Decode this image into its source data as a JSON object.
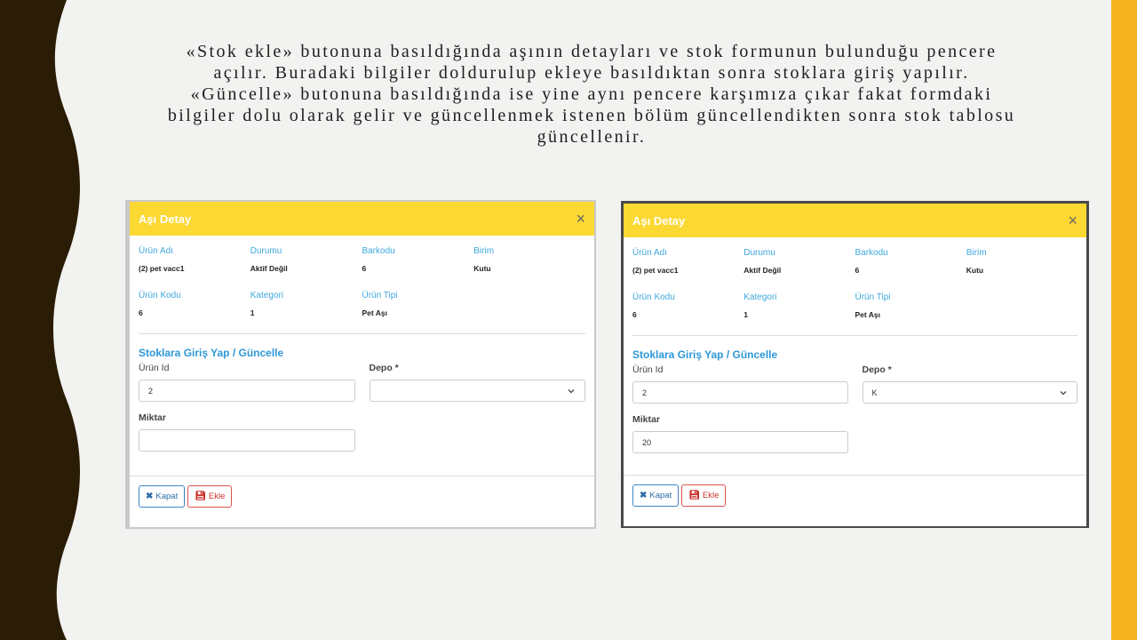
{
  "caption": {
    "lines": [
      "«Stok ekle» butonuna basıldığında aşının detayları ve stok formunun bulunduğu pencere",
      "açılır. Buradaki bilgiler doldurulup ekleye basıldıktan sonra stoklara giriş yapılır.",
      "«Güncelle» butonuna basıldığında ise yine aynı pencere karşımıza çıkar fakat formdaki",
      "bilgiler  dolu olarak gelir ve güncellenmek istenen bölüm güncellendikten sonra stok tablosu",
      "güncellenir."
    ]
  },
  "colors": {
    "header_yellow": "#fcd833",
    "label_blue": "#3fa7dd",
    "accent_orange": "#f7b21f",
    "dark_brown": "#2a1c05"
  },
  "modals": [
    {
      "title": "Aşı Detay",
      "close_icon": "×",
      "labels": {
        "urun_adi": "Ürün Adı",
        "durumu": "Durumu",
        "barkodu": "Barkodu",
        "birim": "Birim",
        "urun_kodu": "Ürün Kodu",
        "kategori": "Kategori",
        "urun_tipi": "Ürün Tipi"
      },
      "values": {
        "urun_adi": "(2) pet vacc1",
        "durumu": "Aktif Değil",
        "barkodu": "6",
        "birim": "Kutu",
        "urun_kodu": "6",
        "kategori": "1",
        "urun_tipi": "Pet Aşı"
      },
      "section_title": "Stoklara Giriş Yap / Güncelle",
      "form": {
        "urun_id_label": "Ürün Id",
        "urun_id_value": "2",
        "depo_label": "Depo *",
        "depo_value": "",
        "miktar_label": "Miktar",
        "miktar_value": ""
      },
      "buttons": {
        "kapat": "Kapat",
        "ekle": "Ekle"
      }
    },
    {
      "title": "Aşı Detay",
      "close_icon": "×",
      "labels": {
        "urun_adi": "Ürün Adı",
        "durumu": "Durumu",
        "barkodu": "Barkodu",
        "birim": "Birim",
        "urun_kodu": "Ürün Kodu",
        "kategori": "Kategori",
        "urun_tipi": "Ürün Tipi"
      },
      "values": {
        "urun_adi": "(2) pet vacc1",
        "durumu": "Aktif Değil",
        "barkodu": "6",
        "birim": "Kutu",
        "urun_kodu": "6",
        "kategori": "1",
        "urun_tipi": "Pet Aşı"
      },
      "section_title": "Stoklara Giriş Yap / Güncelle",
      "form": {
        "urun_id_label": "Ürün Id",
        "urun_id_value": "2",
        "depo_label": "Depo *",
        "depo_value": "K",
        "miktar_label": "Miktar",
        "miktar_value": "20"
      },
      "buttons": {
        "kapat": "Kapat",
        "ekle": "Ekle"
      }
    }
  ]
}
